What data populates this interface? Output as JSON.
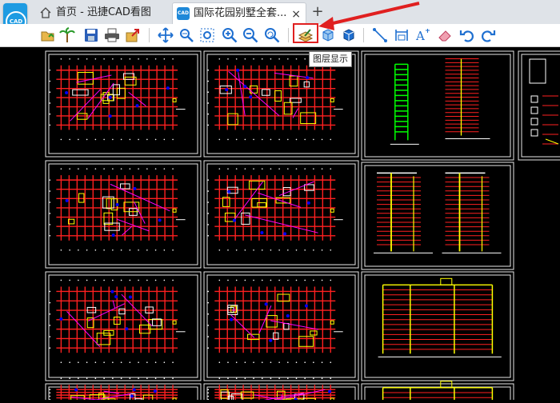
{
  "app": {
    "logo_text": "CAD",
    "accent_color": "#1e9be2"
  },
  "tabs": [
    {
      "label": "首页 - 迅捷CAD看图",
      "icon": "home-icon",
      "active": false
    },
    {
      "label": "国际花园别墅全套...",
      "icon": "cad-file-icon",
      "active": true
    }
  ],
  "new_tab_label": "+",
  "close_label": "×",
  "toolbar": {
    "tools": [
      "open-file-icon",
      "palm-tree-icon",
      "save-icon",
      "print-icon",
      "export-icon",
      "pan-icon",
      "zoom-window-icon",
      "zoom-extents-icon",
      "zoom-in-icon",
      "zoom-out-icon",
      "zoom-previous-icon",
      "layer-display-icon",
      "3d-box-icon",
      "3d-view-icon",
      "line-measure-icon",
      "dimension-icon",
      "text-icon",
      "eraser-icon",
      "undo-icon",
      "redo-icon"
    ],
    "highlighted_tool": "layer-display-icon",
    "highlight_color": "#e02020"
  },
  "tooltip": {
    "text": "图层显示"
  },
  "drawing": {
    "background": "#000000",
    "line_colors": [
      "#ff2020",
      "#ffff00",
      "#00ff00",
      "#ffffff",
      "#0000ff",
      "#ff00ff"
    ],
    "sheets": [
      {
        "type": "floor-plan"
      },
      {
        "type": "floor-plan"
      },
      {
        "type": "elevation-pair"
      },
      {
        "type": "detail"
      },
      {
        "type": "floor-plan"
      },
      {
        "type": "floor-plan"
      },
      {
        "type": "section-pair"
      },
      {
        "type": "floor-plan"
      },
      {
        "type": "floor-plan"
      },
      {
        "type": "elevation-wide"
      },
      {
        "type": "floor-plan"
      },
      {
        "type": "floor-plan"
      },
      {
        "type": "elevation-wide"
      }
    ]
  }
}
